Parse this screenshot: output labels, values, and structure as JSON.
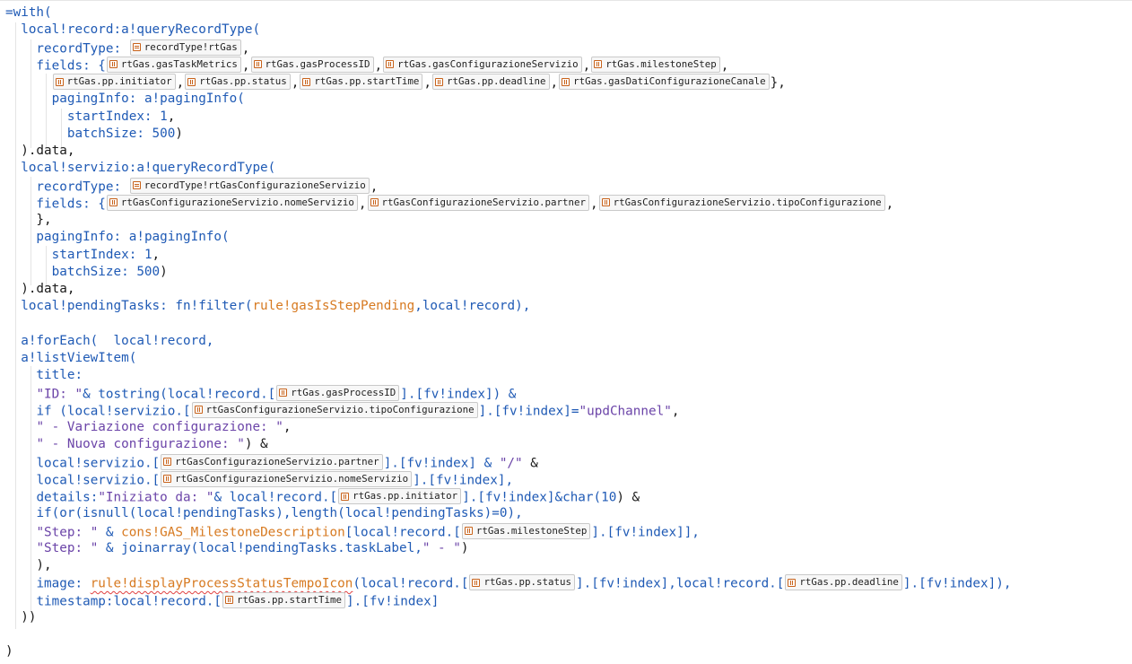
{
  "editor": {
    "lines": [
      [
        {
          "t": "=with(",
          "c": "kw"
        }
      ],
      [
        {
          "t": "  "
        },
        {
          "t": "local!record:a!queryRecordType(",
          "c": "kw"
        }
      ],
      [
        {
          "t": "    recordType: ",
          "c": "kw"
        },
        {
          "chip": "recordType!rtGas",
          "icon": "rt"
        },
        {
          "t": ","
        }
      ],
      [
        {
          "t": "    fields: {",
          "c": "kw"
        },
        {
          "chip": "rtGas.gasTaskMetrics"
        },
        {
          "t": ","
        },
        {
          "chip": "rtGas.gasProcessID"
        },
        {
          "t": ","
        },
        {
          "chip": "rtGas.gasConfigurazioneServizio"
        },
        {
          "t": ","
        },
        {
          "chip": "rtGas.milestoneStep"
        },
        {
          "t": ","
        }
      ],
      [
        {
          "t": "      "
        },
        {
          "chip": "rtGas.pp.initiator"
        },
        {
          "t": ","
        },
        {
          "chip": "rtGas.pp.status"
        },
        {
          "t": ","
        },
        {
          "chip": "rtGas.pp.startTime"
        },
        {
          "t": ","
        },
        {
          "chip": "rtGas.pp.deadline"
        },
        {
          "t": ","
        },
        {
          "chip": "rtGas.gasDatiConfigurazioneCanale"
        },
        {
          "t": "},"
        }
      ],
      [
        {
          "t": "      pagingInfo: ",
          "c": "kw"
        },
        {
          "t": "a!pagingInfo(",
          "c": "kw"
        }
      ],
      [
        {
          "t": "        startIndex: ",
          "c": "kw"
        },
        {
          "t": "1",
          "c": "num"
        },
        {
          "t": ","
        }
      ],
      [
        {
          "t": "        batchSize: ",
          "c": "kw"
        },
        {
          "t": "500",
          "c": "num"
        },
        {
          "t": ")"
        }
      ],
      [
        {
          "t": "  ).data,"
        }
      ],
      [
        {
          "t": "  "
        },
        {
          "t": "local!servizio:a!queryRecordType(",
          "c": "kw"
        }
      ],
      [
        {
          "t": "    recordType: ",
          "c": "kw"
        },
        {
          "chip": "recordType!rtGasConfigurazioneServizio",
          "icon": "rt"
        },
        {
          "t": ","
        }
      ],
      [
        {
          "t": "    fields: {",
          "c": "kw"
        },
        {
          "chip": "rtGasConfigurazioneServizio.nomeServizio"
        },
        {
          "t": ","
        },
        {
          "chip": "rtGasConfigurazioneServizio.partner"
        },
        {
          "t": ","
        },
        {
          "chip": "rtGasConfigurazioneServizio.tipoConfigurazione"
        },
        {
          "t": ","
        }
      ],
      [
        {
          "t": "    },"
        }
      ],
      [
        {
          "t": "    pagingInfo: ",
          "c": "kw"
        },
        {
          "t": "a!pagingInfo(",
          "c": "kw"
        }
      ],
      [
        {
          "t": "      startIndex: ",
          "c": "kw"
        },
        {
          "t": "1",
          "c": "num"
        },
        {
          "t": ","
        }
      ],
      [
        {
          "t": "      batchSize: ",
          "c": "kw"
        },
        {
          "t": "500",
          "c": "num"
        },
        {
          "t": ")"
        }
      ],
      [
        {
          "t": "  ).data,"
        }
      ],
      [
        {
          "t": "  "
        },
        {
          "t": "local!pendingTasks: fn!filter(",
          "c": "kw"
        },
        {
          "t": "rule!gasIsStepPending",
          "c": "rule"
        },
        {
          "t": ",local!record),",
          "c": "kw"
        }
      ],
      [
        {
          "t": ""
        }
      ],
      [
        {
          "t": "  "
        },
        {
          "t": "a!forEach(  local!record,",
          "c": "kw"
        }
      ],
      [
        {
          "t": "  "
        },
        {
          "t": "a!listViewItem(",
          "c": "kw"
        }
      ],
      [
        {
          "t": "    title:",
          "c": "kw"
        }
      ],
      [
        {
          "t": "    "
        },
        {
          "t": "\"ID: \"",
          "c": "str"
        },
        {
          "t": "& tostring(local!record.[",
          "c": "kw"
        },
        {
          "chip": "rtGas.gasProcessID"
        },
        {
          "t": "].[fv!index]) &",
          "c": "kw"
        }
      ],
      [
        {
          "t": "    "
        },
        {
          "t": "if (local!servizio.[",
          "c": "kw"
        },
        {
          "chip": "rtGasConfigurazioneServizio.tipoConfigurazione"
        },
        {
          "t": "].[fv!index]=",
          "c": "kw"
        },
        {
          "t": "\"updChannel\"",
          "c": "str"
        },
        {
          "t": ","
        }
      ],
      [
        {
          "t": "    "
        },
        {
          "t": "\" - Variazione configurazione: \"",
          "c": "str"
        },
        {
          "t": ","
        }
      ],
      [
        {
          "t": "    "
        },
        {
          "t": "\" - Nuova configurazione: \"",
          "c": "str"
        },
        {
          "t": ") &"
        }
      ],
      [
        {
          "t": "    "
        },
        {
          "t": "local!servizio.[",
          "c": "kw"
        },
        {
          "chip": "rtGasConfigurazioneServizio.partner"
        },
        {
          "t": "].[fv!index] & ",
          "c": "kw"
        },
        {
          "t": "\"/\"",
          "c": "str"
        },
        {
          "t": " &"
        }
      ],
      [
        {
          "t": "    "
        },
        {
          "t": "local!servizio.[",
          "c": "kw"
        },
        {
          "chip": "rtGasConfigurazioneServizio.nomeServizio"
        },
        {
          "t": "].[fv!index],",
          "c": "kw"
        }
      ],
      [
        {
          "t": "    "
        },
        {
          "t": "details:",
          "c": "kw"
        },
        {
          "t": "\"Iniziato da: \"",
          "c": "str"
        },
        {
          "t": "& local!record.[",
          "c": "kw"
        },
        {
          "chip": "rtGas.pp.initiator"
        },
        {
          "t": "].[fv!index]&char(",
          "c": "kw"
        },
        {
          "t": "10",
          "c": "num"
        },
        {
          "t": ") &"
        }
      ],
      [
        {
          "t": "    "
        },
        {
          "t": "if(or(isnull(local!pendingTasks),length(local!pendingTasks)=0),",
          "c": "kw"
        }
      ],
      [
        {
          "t": "    "
        },
        {
          "t": "\"Step: \"",
          "c": "str"
        },
        {
          "t": " & ",
          "c": "kw"
        },
        {
          "t": "cons!GAS_MilestoneDescription",
          "c": "rule"
        },
        {
          "t": "[local!record.[",
          "c": "kw"
        },
        {
          "chip": "rtGas.milestoneStep"
        },
        {
          "t": "].[fv!index]],",
          "c": "kw"
        }
      ],
      [
        {
          "t": "    "
        },
        {
          "t": "\"Step: \"",
          "c": "str"
        },
        {
          "t": " & joinarray(local!pendingTasks.taskLabel,",
          "c": "kw"
        },
        {
          "t": "\" - \"",
          "c": "str"
        },
        {
          "t": ")"
        }
      ],
      [
        {
          "t": "    ),"
        }
      ],
      [
        {
          "t": "    "
        },
        {
          "t": "image: ",
          "c": "kw"
        },
        {
          "t": "rule!displayProcessStatusTempoIcon",
          "c": "rule sq"
        },
        {
          "t": "(local!record.[",
          "c": "kw"
        },
        {
          "chip": "rtGas.pp.status"
        },
        {
          "t": "].[fv!index],local!record.[",
          "c": "kw"
        },
        {
          "chip": "rtGas.pp.deadline"
        },
        {
          "t": "].[fv!index]),",
          "c": "kw"
        }
      ],
      [
        {
          "t": "    "
        },
        {
          "t": "timestamp:local!record.[",
          "c": "kw"
        },
        {
          "chip": "rtGas.pp.startTime"
        },
        {
          "t": "].[fv!index]",
          "c": "kw"
        }
      ],
      [
        {
          "t": "  ))"
        }
      ],
      [
        {
          "t": ""
        }
      ],
      [
        {
          "t": ")"
        }
      ]
    ]
  }
}
